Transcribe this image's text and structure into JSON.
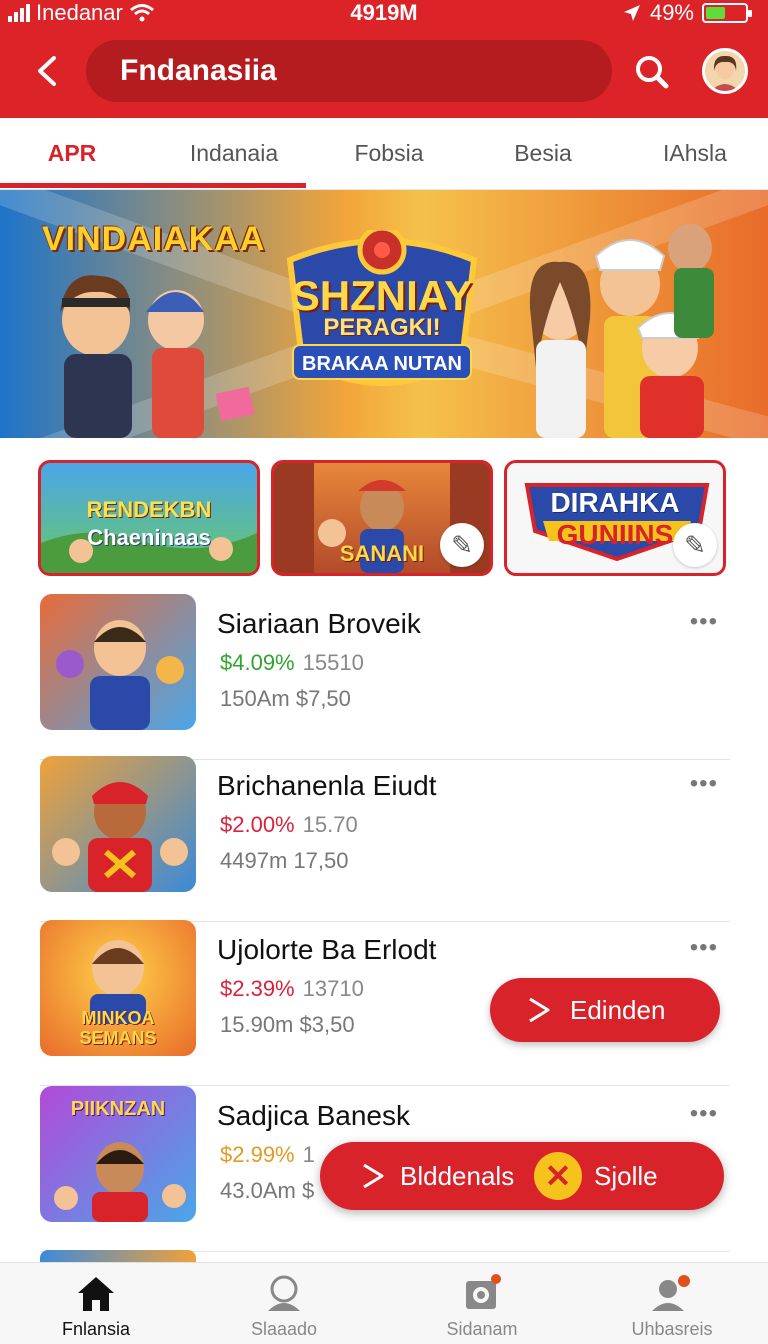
{
  "status_bar": {
    "carrier": "Inedanar",
    "time": "4919M",
    "battery": "49%",
    "battery_level": 0.49
  },
  "header": {
    "title": "Fndanasiia",
    "back_icon": "back-arrow-icon",
    "search_icon": "search-icon",
    "avatar_icon": "user-avatar"
  },
  "tabs": [
    {
      "label": "APR",
      "active": true
    },
    {
      "label": "Indanaia",
      "active": false
    },
    {
      "label": "Fobsia",
      "active": false
    },
    {
      "label": "Besia",
      "active": false
    },
    {
      "label": "IAhsla",
      "active": false
    }
  ],
  "hero": {
    "left_title": "VINDAIAKAA",
    "title_line1": "SHZNIAY",
    "title_line2": "PERAGKI!",
    "title_line3": "BRAKAA NUTAN"
  },
  "cards": [
    {
      "line1": "RENDEKBN",
      "line2": "Chaeninaas"
    },
    {
      "line1": "SANANI",
      "corner_icon": "edit-icon"
    },
    {
      "line1": "DIRAHKA",
      "line2": "GUNIINS",
      "corner_icon": "edit-icon"
    }
  ],
  "items": [
    {
      "title": "Siariaan Broveik",
      "pct": "$4.09%",
      "pct_color": "#2fa52f",
      "value1": "15510",
      "line2_a": "150Am",
      "line2_b": "$7,50"
    },
    {
      "title": "Brichanenla Eiudt",
      "pct": "$2.00%",
      "pct_color": "#d8233a",
      "value1": "15.70",
      "line2_a": "4497m",
      "line2_b": "17,50"
    },
    {
      "title": "Ujolorte Ba Erlodt",
      "pct": "$2.39%",
      "pct_color": "#d8233a",
      "value1": "13710",
      "line2_a": "15.90m",
      "line2_b": "$3,50",
      "thumb_text": "MINKOA SEMANS"
    },
    {
      "title": "Sadjica Banesk",
      "pct": "$2.99%",
      "pct_color": "#e39a22",
      "value1": "1",
      "line2_a": "43.0Am",
      "line2_b": "$",
      "thumb_text": "PIIKNZAN"
    }
  ],
  "more_label": "•••",
  "fab_edit": {
    "label": "Edinden",
    "icon": "play-icon"
  },
  "fab_pill": {
    "label": "Blddenals",
    "close_icon": "close-icon",
    "label2": "Sjolle"
  },
  "bottom_nav": [
    {
      "label": "Fnlansia",
      "icon": "home-icon",
      "active": true
    },
    {
      "label": "Slaaado",
      "icon": "profile-icon",
      "active": false
    },
    {
      "label": "Sidanam",
      "icon": "camera-icon",
      "active": false
    },
    {
      "label": "Uhbasreis",
      "icon": "user-settings-icon",
      "active": false
    }
  ],
  "colors": {
    "brand": "#dc2327",
    "brand_dark": "#b41c20",
    "accent_yellow": "#f6c31c"
  }
}
